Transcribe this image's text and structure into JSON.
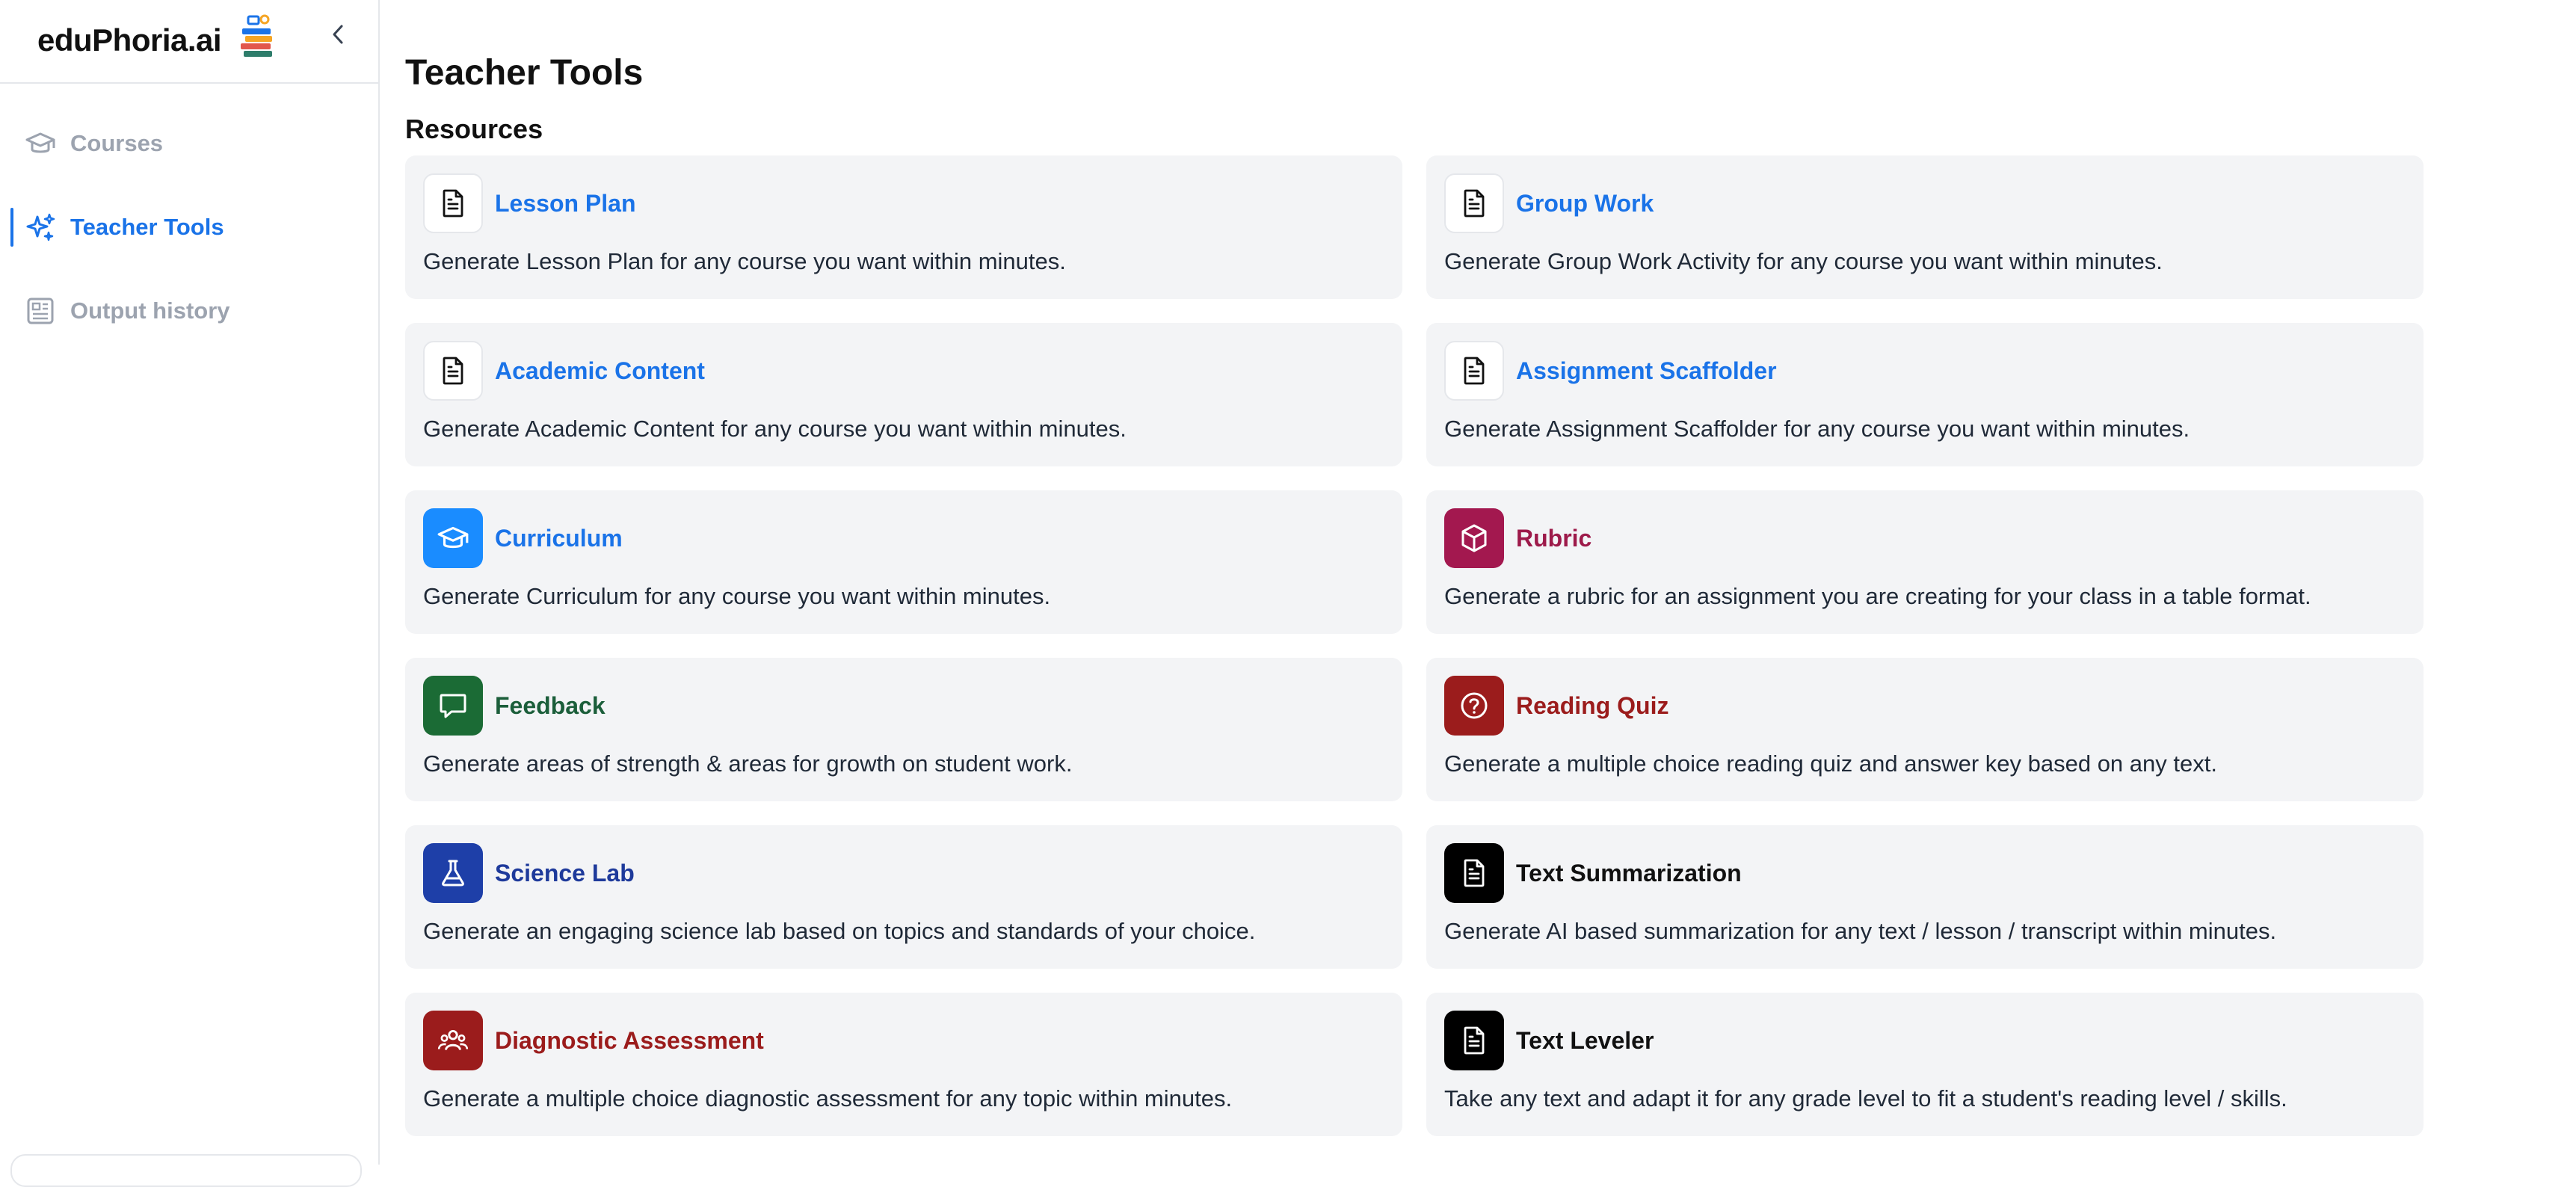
{
  "brand": {
    "name": "eduPhoria.ai"
  },
  "sidebar": {
    "items": [
      {
        "label": "Courses",
        "icon": "graduation-cap-icon",
        "active": false
      },
      {
        "label": "Teacher Tools",
        "icon": "sparkles-icon",
        "active": true
      },
      {
        "label": "Output history",
        "icon": "newspaper-icon",
        "active": false
      }
    ]
  },
  "main": {
    "title": "Teacher Tools",
    "section_title": "Resources",
    "cards": [
      {
        "title": "Lesson Plan",
        "desc": "Generate Lesson Plan for any course you want within minutes.",
        "icon": "document-icon",
        "accent": "#1a73e8",
        "icon_bg": "#ffffff"
      },
      {
        "title": "Group Work",
        "desc": "Generate Group Work Activity for any course you want within minutes.",
        "icon": "document-icon",
        "accent": "#1a73e8",
        "icon_bg": "#ffffff"
      },
      {
        "title": "Academic Content",
        "desc": "Generate Academic Content for any course you want within minutes.",
        "icon": "document-icon",
        "accent": "#1a73e8",
        "icon_bg": "#ffffff"
      },
      {
        "title": "Assignment Scaffolder",
        "desc": "Generate Assignment Scaffolder for any course you want within minutes.",
        "icon": "document-icon",
        "accent": "#1a73e8",
        "icon_bg": "#ffffff"
      },
      {
        "title": "Curriculum",
        "desc": "Generate Curriculum for any course you want within minutes.",
        "icon": "graduation-cap-icon",
        "accent": "#1a73e8",
        "icon_bg": "#1a8cff"
      },
      {
        "title": "Rubric",
        "desc": "Generate a rubric for an assignment you are creating for your class in a table format.",
        "icon": "cube-icon",
        "accent": "#9d1a4a",
        "icon_bg": "#a3184f"
      },
      {
        "title": "Feedback",
        "desc": "Generate areas of strength & areas for growth on student work.",
        "icon": "chat-bubble-icon",
        "accent": "#1b5e3a",
        "icon_bg": "#1b6b35"
      },
      {
        "title": "Reading Quiz",
        "desc": "Generate a multiple choice reading quiz and answer key based on any text.",
        "icon": "question-circle-icon",
        "accent": "#9b1c1c",
        "icon_bg": "#9b1c1c"
      },
      {
        "title": "Science Lab",
        "desc": "Generate an engaging science lab based on topics and standards of your choice.",
        "icon": "flask-icon",
        "accent": "#1e3a9b",
        "icon_bg": "#1e3fa8"
      },
      {
        "title": "Text Summarization",
        "desc": "Generate AI based summarization for any text / lesson / transcript within minutes.",
        "icon": "document-icon",
        "accent": "#111111",
        "icon_bg": "#000000"
      },
      {
        "title": "Diagnostic Assessment",
        "desc": "Generate a multiple choice diagnostic assessment for any topic within minutes.",
        "icon": "users-group-icon",
        "accent": "#9b1c1c",
        "icon_bg": "#9b1c1c"
      },
      {
        "title": "Text Leveler",
        "desc": "Take any text and adapt it for any grade level to fit a student's reading level / skills.",
        "icon": "document-icon",
        "accent": "#111111",
        "icon_bg": "#000000"
      }
    ]
  }
}
